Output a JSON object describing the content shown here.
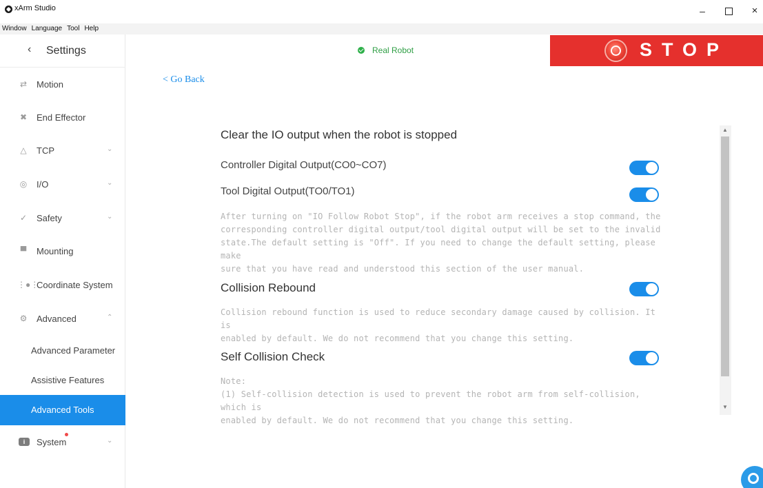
{
  "app": {
    "title": "xArm Studio"
  },
  "window_controls": {
    "minimize": "–",
    "close": "×"
  },
  "menubar": [
    "Window",
    "Language",
    "Tool",
    "Help"
  ],
  "sidebar": {
    "header": "Settings",
    "items": [
      {
        "label": "Motion",
        "icon": "motion-icon"
      },
      {
        "label": "End Effector",
        "icon": "end-effector-icon"
      },
      {
        "label": "TCP",
        "icon": "tcp-icon",
        "expandable": true
      },
      {
        "label": "I/O",
        "icon": "io-icon",
        "expandable": true
      },
      {
        "label": "Safety",
        "icon": "safety-icon",
        "expandable": true
      },
      {
        "label": "Mounting",
        "icon": "mounting-icon"
      },
      {
        "label": "Coordinate System",
        "icon": "coordinate-icon"
      },
      {
        "label": "Advanced",
        "icon": "advanced-icon",
        "expanded": true
      }
    ],
    "subitems": [
      {
        "label": "Advanced Parameter"
      },
      {
        "label": "Assistive Features"
      },
      {
        "label": "Advanced Tools",
        "active": true
      }
    ],
    "system": {
      "label": "System",
      "icon": "system-icon",
      "badge": true
    }
  },
  "topbar": {
    "status": "Real Robot",
    "status_color": "#2eb04a",
    "stop_label": "STOP",
    "stop_color": "#e5302d"
  },
  "go_back": "< Go Back",
  "section": {
    "title": "Clear the IO output when the robot is stopped",
    "rows": [
      {
        "label": "Controller Digital Output(CO0~CO7)",
        "enabled": true
      },
      {
        "label": "Tool Digital Output(TO0/TO1)",
        "enabled": true
      }
    ],
    "description": [
      "After turning on \"IO Follow Robot Stop\", if the robot arm receives a stop command, the",
      "corresponding controller digital output/tool digital output will be set to the invalid",
      "state.The default setting is \"Off\". If you need to change the default setting, please make",
      "sure that you have read and understood this section of the user manual."
    ]
  },
  "collision_rebound": {
    "title": "Collision Rebound",
    "enabled": true,
    "description": [
      "Collision rebound function is used to reduce secondary damage caused by collision. It is",
      "enabled by default. We do not recommend that you change this setting."
    ]
  },
  "self_collision": {
    "title": "Self Collision Check",
    "enabled": true,
    "description": [
      "Note:",
      "(1) Self-collision detection is used to prevent the robot arm from self-collision, which is",
      "enabled by default. We do not recommend that you change this setting."
    ]
  },
  "accent_color": "#1a8de9"
}
